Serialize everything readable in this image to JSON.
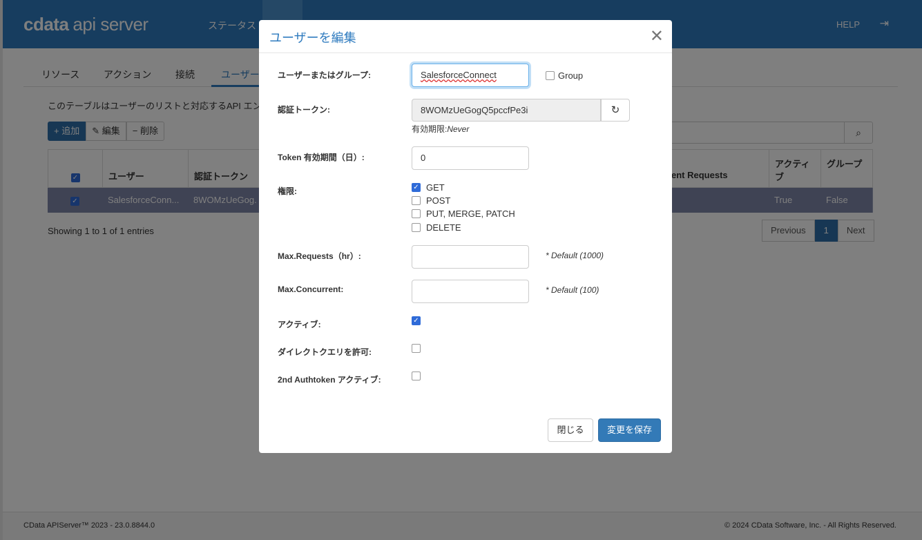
{
  "app": {
    "logo_cdata": "cdata",
    "logo_api": "api server",
    "nav_status": "ステータス",
    "help": "HELP"
  },
  "subnav": [
    "リソース",
    "アクション",
    "接続",
    "ユーザー"
  ],
  "users_page": {
    "description": "このテーブルはユーザーのリストと対応するAPI エン",
    "add": "+ 追加",
    "edit": "編集",
    "delete": "− 削除",
    "columns": {
      "user": "ユーザー",
      "token": "認証トークン",
      "requests": "ent Requests",
      "active": "アクティブ",
      "group": "グループ"
    },
    "row": {
      "user": "SalesforceConn...",
      "token": "8WOMzUeGog.",
      "active": "True",
      "group": "False"
    },
    "showing": "Showing 1 to 1 of 1 entries",
    "pager": {
      "previous": "Previous",
      "current": "1",
      "next": "Next"
    }
  },
  "footer": {
    "left": "CData APIServer™ 2023 - 23.0.8844.0",
    "right": "© 2024 CData Software, Inc. - All Rights Reserved."
  },
  "modal": {
    "title": "ユーザーを編集",
    "user_label": "ユーザーまたはグループ:",
    "user_value": "SalesforceConnect",
    "group_label": "Group",
    "group_checked": false,
    "token_label": "認証トークン:",
    "token_value": "8WOMzUeGogQ5pccfPe3i",
    "expiry_label": "有効期限:",
    "expiry_value": "Never",
    "token_days_label": "Token 有効期間（日）:",
    "token_days_value": "0",
    "perm_label": "権限:",
    "perms": [
      {
        "name": "GET",
        "checked": true
      },
      {
        "name": "POST",
        "checked": false
      },
      {
        "name": "PUT, MERGE, PATCH",
        "checked": false
      },
      {
        "name": "DELETE",
        "checked": false
      }
    ],
    "max_req_label": "Max.Requests（hr）:",
    "max_req_default": "* Default (1000)",
    "max_conc_label": "Max.Concurrent:",
    "max_conc_default": "* Default (100)",
    "active_label": "アクティブ:",
    "active_checked": true,
    "direct_label": "ダイレクトクエリを許可:",
    "direct_checked": false,
    "auth2_label": "2nd Authtoken アクティブ:",
    "auth2_checked": false,
    "close_button": "閉じる",
    "save_button": "変更を保存"
  }
}
